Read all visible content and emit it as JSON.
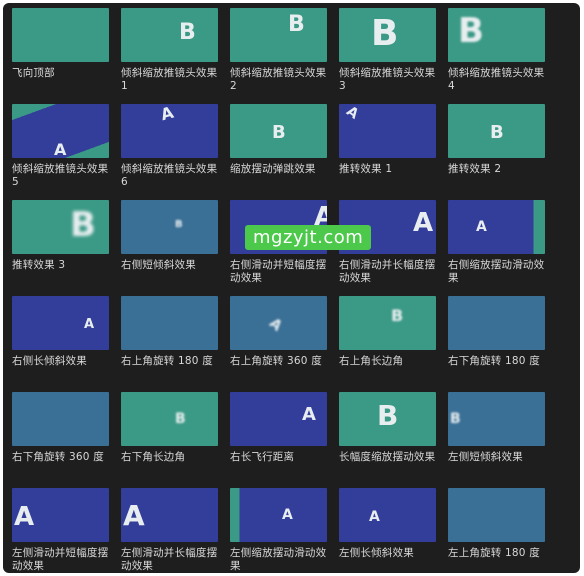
{
  "effects": [
    {
      "label": "飞向顶部",
      "glyph": "",
      "bg": "teal"
    },
    {
      "label": "倾斜缩放推镜头效果 1",
      "glyph": "B",
      "bg": "teal"
    },
    {
      "label": "倾斜缩放推镜头效果 2",
      "glyph": "B",
      "bg": "teal"
    },
    {
      "label": "倾斜缩放推镜头效果 3",
      "glyph": "B",
      "bg": "teal"
    },
    {
      "label": "倾斜缩放推镜头效果 4",
      "glyph": "B",
      "bg": "teal"
    },
    {
      "label": "倾斜缩放推镜头效果 5",
      "glyph": "A",
      "bg": "mix"
    },
    {
      "label": "倾斜缩放推镜头效果 6",
      "glyph": "A",
      "bg": "indigo"
    },
    {
      "label": "缩放摆动弹跳效果",
      "glyph": "B",
      "bg": "teal"
    },
    {
      "label": "推转效果 1",
      "glyph": "A",
      "bg": "indigo"
    },
    {
      "label": "推转效果 2",
      "glyph": "B",
      "bg": "teal"
    },
    {
      "label": "推转效果 3",
      "glyph": "B",
      "bg": "teal"
    },
    {
      "label": "右侧短倾斜效果",
      "glyph": "B",
      "bg": "steel"
    },
    {
      "label": "右侧滑动并短幅度摆动效果",
      "glyph": "A",
      "bg": "indigo"
    },
    {
      "label": "右侧滑动并长幅度摆动效果",
      "glyph": "A",
      "bg": "indigo"
    },
    {
      "label": "右侧缩放摆动滑动效果",
      "glyph": "A",
      "bg": "mix2"
    },
    {
      "label": "右侧长倾斜效果",
      "glyph": "A",
      "bg": "indigo"
    },
    {
      "label": "右上角旋转 180 度",
      "glyph": "",
      "bg": "steel"
    },
    {
      "label": "右上角旋转 360 度",
      "glyph": "A",
      "bg": "steel"
    },
    {
      "label": "右上角长边角",
      "glyph": "B",
      "bg": "teal"
    },
    {
      "label": "右下角旋转 180 度",
      "glyph": "",
      "bg": "steel"
    },
    {
      "label": "右下角旋转 360 度",
      "glyph": "",
      "bg": "steel"
    },
    {
      "label": "右下角长边角",
      "glyph": "B",
      "bg": "teal"
    },
    {
      "label": "右长飞行距离",
      "glyph": "A",
      "bg": "indigo"
    },
    {
      "label": "长幅度缩放摆动效果",
      "glyph": "B",
      "bg": "teal"
    },
    {
      "label": "左侧短倾斜效果",
      "glyph": "B",
      "bg": "steel"
    },
    {
      "label": "左侧滑动并短幅度摆动效果",
      "glyph": "A",
      "bg": "indigo"
    },
    {
      "label": "左侧滑动并长幅度摆动效果",
      "glyph": "A",
      "bg": "indigo"
    },
    {
      "label": "左侧缩放摆动滑动效果",
      "glyph": "A",
      "bg": "mix3"
    },
    {
      "label": "左侧长倾斜效果",
      "glyph": "A",
      "bg": "indigo"
    },
    {
      "label": "左上角旋转 180 度",
      "glyph": "",
      "bg": "steel"
    }
  ],
  "watermark": "mgzyjt.com",
  "colors": {
    "teal": "#3b9a86",
    "indigo": "#333d9a",
    "steel": "#3a6f96",
    "panel": "#1e1e1e",
    "watermark": "#4cc84a"
  }
}
